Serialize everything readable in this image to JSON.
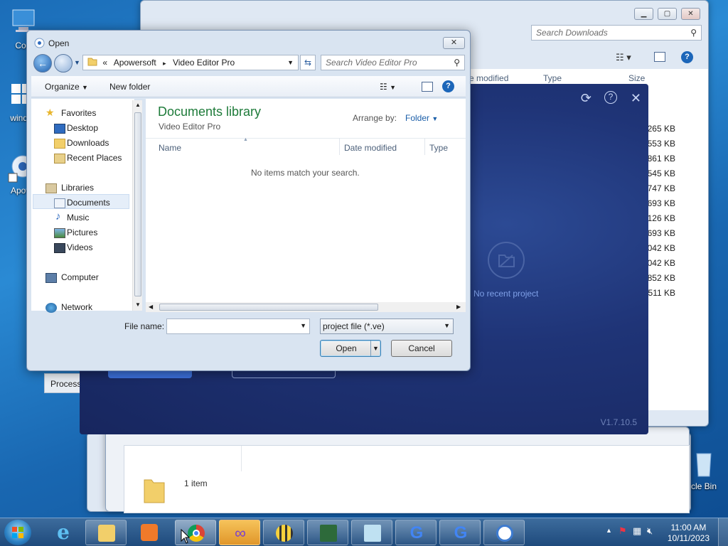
{
  "desktop": {
    "icons": [
      {
        "label": "Com"
      },
      {
        "label": "windo"
      },
      {
        "label": "Apow"
      },
      {
        "label": "cle Bin"
      }
    ]
  },
  "downloads_window": {
    "search_placeholder": "Search Downloads",
    "columns": [
      "e modified",
      "Type",
      "Size"
    ],
    "sizes": [
      "265 KB",
      "553 KB",
      "861 KB",
      "545 KB",
      "747 KB",
      "693 KB",
      "126 KB",
      "693 KB",
      "042 KB",
      "042 KB",
      "852 KB",
      "511 KB"
    ],
    "status": "1 item",
    "process_label": "Process"
  },
  "editor": {
    "no_recent": "No recent project",
    "version": "V1.7.10.5"
  },
  "dialog": {
    "title": "Open",
    "breadcrumb": [
      "«",
      "Apowersoft",
      "Video Editor Pro"
    ],
    "search_placeholder": "Search Video Editor Pro",
    "toolbar": {
      "organize": "Organize",
      "new_folder": "New folder"
    },
    "nav": {
      "favorites": "Favorites",
      "desktop": "Desktop",
      "downloads": "Downloads",
      "recent_places": "Recent Places",
      "libraries": "Libraries",
      "documents": "Documents",
      "music": "Music",
      "pictures": "Pictures",
      "videos": "Videos",
      "computer": "Computer",
      "network": "Network"
    },
    "library_title": "Documents library",
    "library_sub": "Video Editor Pro",
    "arrange_by_label": "Arrange by:",
    "arrange_by_value": "Folder",
    "columns": {
      "name": "Name",
      "date_modified": "Date modified",
      "type": "Type"
    },
    "empty_message": "No items match your search.",
    "file_name_label": "File name:",
    "file_name_value": "",
    "file_type": "project file (*.ve)",
    "open_label": "Open",
    "cancel_label": "Cancel"
  },
  "taskbar": {
    "time": "11:00 AM",
    "date": "10/11/2023"
  },
  "colors": {
    "accent": "#1e7b3a",
    "link": "#1a5ea8",
    "editor_bg": "#1f3477"
  }
}
